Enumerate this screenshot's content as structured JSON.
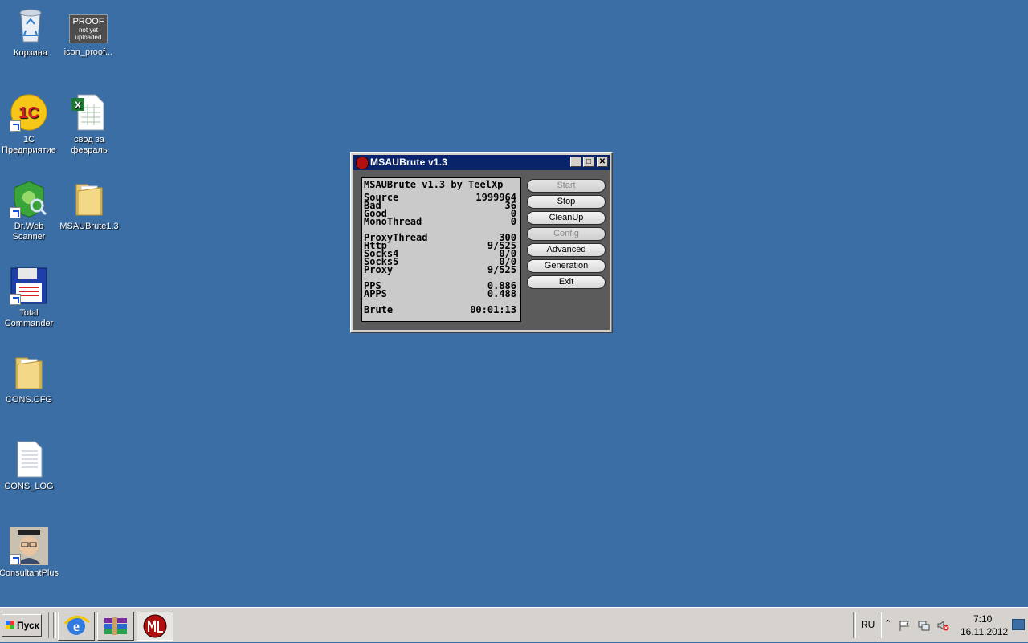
{
  "desktop": {
    "icons": [
      {
        "label": "Корзина"
      },
      {
        "label": "icon_proof..."
      },
      {
        "label": "1C\nПредприятие"
      },
      {
        "label": "свод за\nфевраль"
      },
      {
        "label": "Dr.Web\nScanner"
      },
      {
        "label": "MSAUBrute1.3"
      },
      {
        "label": "Total\nCommander"
      },
      {
        "label": "CONS.CFG"
      },
      {
        "label": "CONS_LOG"
      },
      {
        "label": "ConsultantPlus"
      }
    ],
    "proof_icon_text": {
      "line1": "PROOF",
      "line2": "not yet",
      "line3": "uploaded"
    },
    "onec_text": "1C"
  },
  "window": {
    "title": "MSAUBrute v1.3",
    "controls": {
      "minimize": "_",
      "maximize": "□",
      "close": "✕"
    },
    "stats_header": "MSAUBrute v1.3 by TeelXp",
    "stats": {
      "source": {
        "label": "Source",
        "value": "1999964"
      },
      "bad": {
        "label": "Bad",
        "value": "36"
      },
      "good": {
        "label": "Good",
        "value": "0"
      },
      "monothread": {
        "label": "MonoThread",
        "value": "0"
      },
      "proxythread": {
        "label": "ProxyThread",
        "value": "300"
      },
      "http": {
        "label": "Http",
        "value": "9/525"
      },
      "socks4": {
        "label": "Socks4",
        "value": "0/0"
      },
      "socks5": {
        "label": "Socks5",
        "value": "0/0"
      },
      "proxy": {
        "label": "Proxy",
        "value": "9/525"
      },
      "pps": {
        "label": "PPS",
        "value": "0.886"
      },
      "apps": {
        "label": "APPS",
        "value": "0.488"
      },
      "brute": {
        "label": "Brute",
        "value": "00:01:13"
      }
    },
    "buttons": {
      "start": "Start",
      "stop": "Stop",
      "cleanup": "CleanUp",
      "config": "Config",
      "advanced": "Advanced",
      "generation": "Generation",
      "exit": "Exit"
    }
  },
  "taskbar": {
    "start_label": "Пуск",
    "language": "RU",
    "time": "7:10",
    "date": "16.11.2012"
  },
  "colors": {
    "desktop": "#3a6ea5",
    "titlebar": "#0a246a",
    "panel": "#5b5b5b"
  }
}
